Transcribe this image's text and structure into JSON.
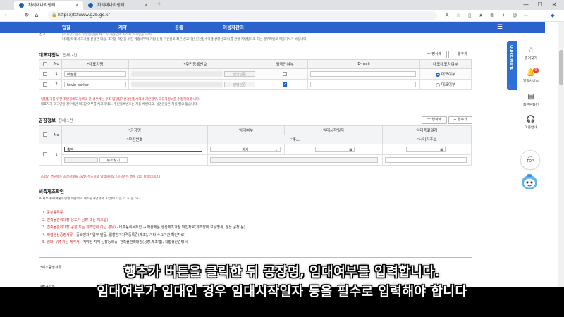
{
  "browser": {
    "tabs": [
      {
        "title": "차세대나라장터",
        "active": true
      },
      {
        "title": "차세대나라장터",
        "active": false
      }
    ],
    "new_tab": "+",
    "url": "https://tstwww.g2b.go.kr",
    "window_controls": {
      "minimize": "—",
      "maximize": "☐",
      "close": "✕"
    },
    "nav": {
      "back": "←",
      "forward": "→",
      "refresh": "↻",
      "home": "⌂"
    }
  },
  "site_nav": {
    "items": [
      "입찰",
      "계약",
      "공통",
      "이용자관리"
    ],
    "menu_icon": "☰"
  },
  "notice": {
    "label": "참고",
    "lines": [
      "(조치상 : 창조기업(신청원) 채크 후 제출양에 따라서 조기입을 하여)",
      "나라장터에서 조기업 신청한 다음, 조기업 확인을 위한 계층세부터 기업 신청 기준일로 최근 신고하신 원천징수이행 상황신고서)를 관할 지방청으로 하는 첨부파일로 제출하셔기 바랍니다."
    ]
  },
  "rep_section": {
    "title": "대표자정보",
    "count": "전체 2건",
    "delete_btn": "一 명삭제",
    "add_btn": "+ 행추가",
    "headers": [
      "No",
      "*대표자명",
      "*주민등록번호",
      "외국인여부",
      "E-mail",
      "대표대표자여부"
    ],
    "rows": [
      {
        "no": "1",
        "name": "이정환",
        "verify": "실명인증",
        "foreigner": false,
        "rep_label": "대표여부",
        "rep_checked": true
      },
      {
        "no": "2",
        "name": "kevin parker",
        "verify": "실명인증",
        "foreigner": true,
        "rep_label": "대표여부",
        "rep_checked": false
      }
    ],
    "notes": [
      "· 입찰참가를 위한 조달청에도 등록의 한 경우에는 무조 업정장가변경신청시에서 기본정부, 대표자정보를 수정해야 합니다.",
      "· 대표자가 외국인일 경우에만 외국인여부를 체크하세요. 주민등록번호는 자동 체번되고, 실명인증은 자실 필요 없습니다."
    ]
  },
  "factory_section": {
    "title": "공장정보",
    "count": "전체 1건",
    "delete_btn": "一 행삭제",
    "add_btn": "+ 행추가",
    "headers_row1": [
      "No",
      "*공장명",
      "임대여부",
      "임대시작일자",
      "임대종료일자"
    ],
    "headers_row2": [
      "*우편번호",
      "*주소",
      "*나머지주소"
    ],
    "row": {
      "no": "1",
      "factory_name": "축엑",
      "rent": "자가",
      "address_search_btn": "주소찾기"
    },
    "note": "· 조합인 경우에는 공장정보를 사업자주소지로 입력하세요 (공장명은 필수 입력 항목입니다.)"
  },
  "direct_section": {
    "title": "비축제조확인",
    "desc": "※ 제무제표(매출유형별 매출액과 제조원가명세서 포함)에 다음 각 호 중 하나",
    "items": [
      {
        "num": "1.",
        "text": "공장등록증",
        "detail": ""
      },
      {
        "num": "2.",
        "text": "건축물관리대장(용도가 공장 또는 제조업)",
        "detail": ""
      },
      {
        "num": "3.",
        "text": "건축물관리대장(공장 또는 제조업이 아닌 경우)",
        "detail": " - 비축등록목투입 → 매출제품 생산제조과정 확인자료(제조장비 보유명세, 생산 공정 등)"
      },
      {
        "num": "4.",
        "text": "직접생산증명서류",
        "detail": " - 중소벤처기업부 발급, 입찰참가자격등록증(제조), 기타 수요기관 확인자료)"
      },
      {
        "num": "5.",
        "text": "임대, 위주기공 계약서",
        "detail": " - 계약된 지역 공장등록증, 건축물관리대장(공장,제조업), 직접생산증명서"
      }
    ],
    "bottom_rows": [
      "*제조증명서류",
      "*발급기관"
    ]
  },
  "quick_menu": {
    "tab_label": "Quick Menu",
    "items": [
      {
        "label": "즐겨찾기",
        "icon": "☆"
      },
      {
        "label": "알림서비스",
        "icon": "🔔",
        "badge": "0"
      },
      {
        "label": "최근본화면",
        "icon": "▤"
      },
      {
        "label": "이용안내",
        "icon": "🎧"
      }
    ],
    "top_label": "TOP"
  },
  "subtitle": {
    "line1": "행추가 버튼을 클릭한 뒤 공장명, 임대여부를 입력합니다.",
    "line2": "임대여부가 임대인 경우 임대시작일자 등을 필수로 입력해야 합니다"
  }
}
